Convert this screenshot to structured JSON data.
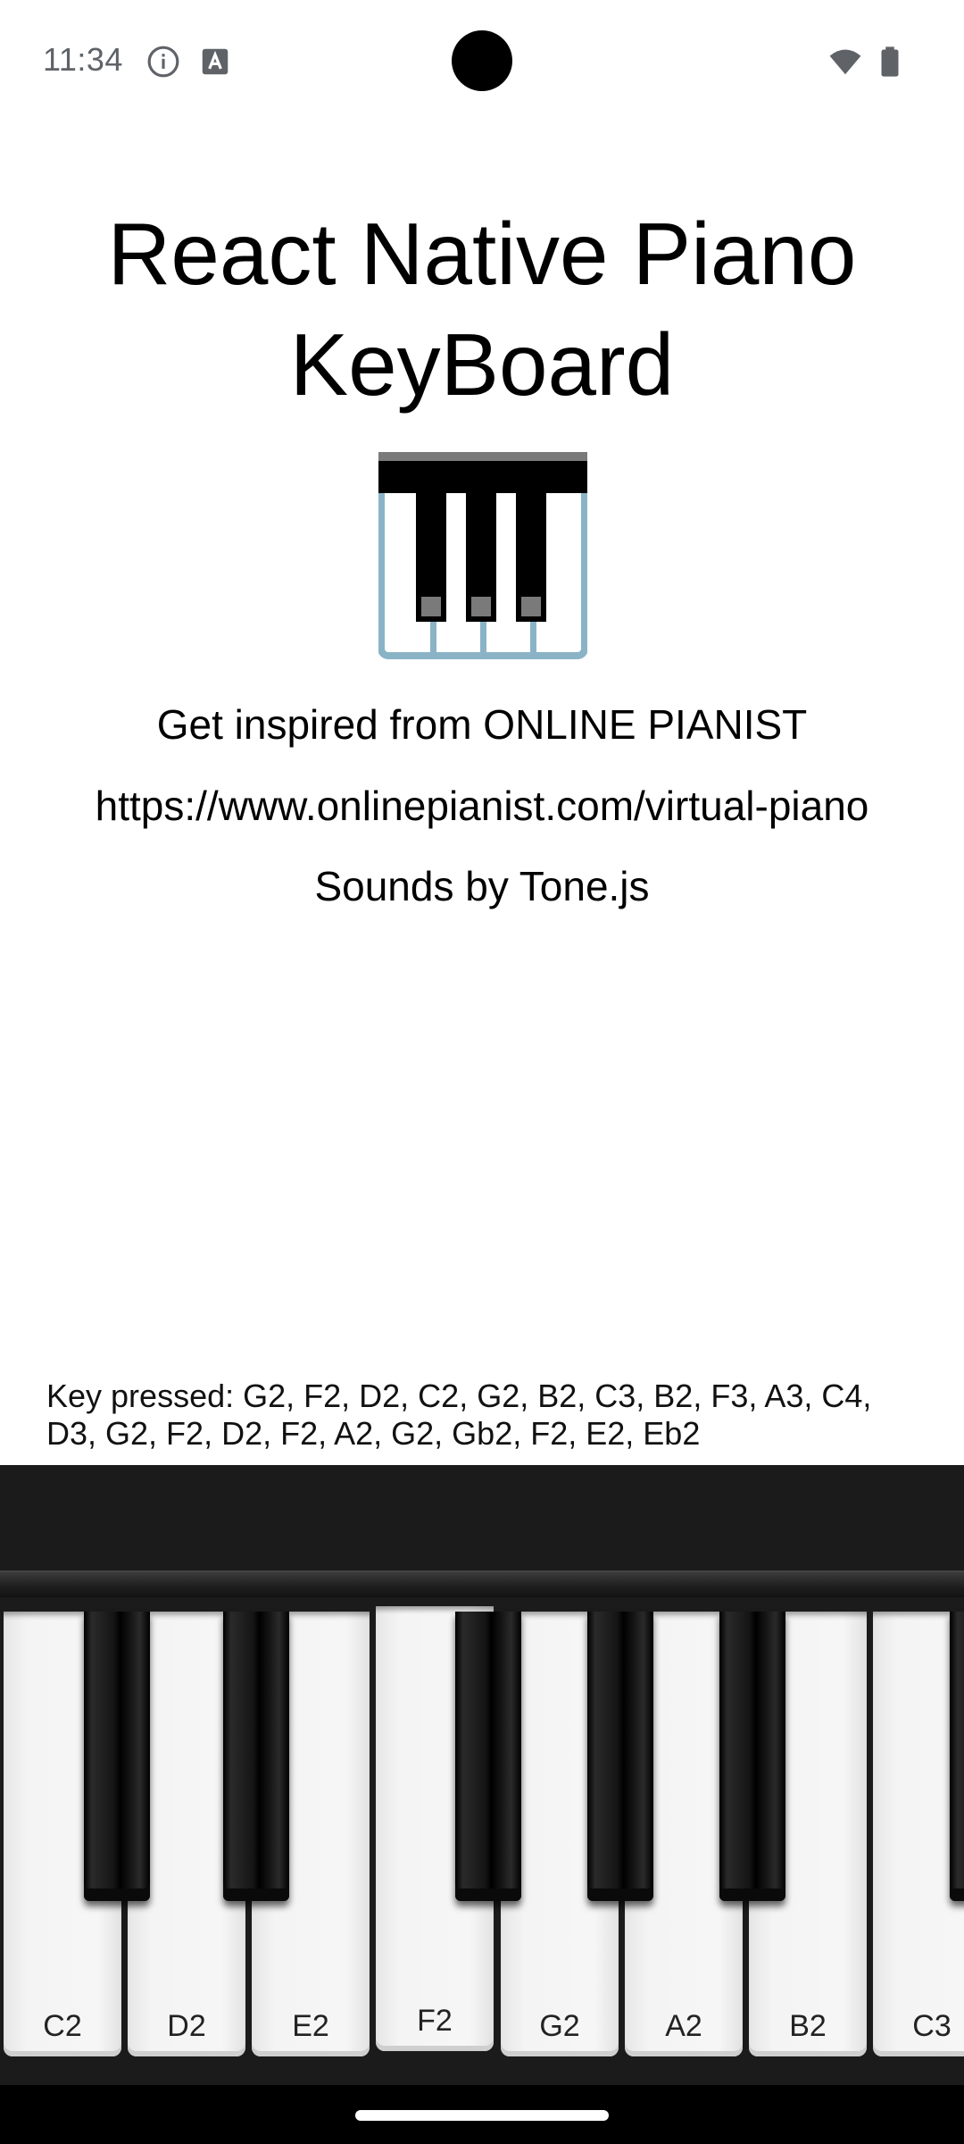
{
  "status_bar": {
    "time": "11:34",
    "icons": [
      "info-icon",
      "text-a-icon",
      "wifi-icon",
      "battery-icon"
    ]
  },
  "header": {
    "title": "React Native Piano KeyBoard",
    "logo_icon": "piano-keys-icon",
    "inspired_line": "Get inspired from ONLINE PIANIST",
    "url_line": "https://www.onlinepianist.com/virtual-piano",
    "sounds_line": "Sounds by Tone.js"
  },
  "key_pressed": "Key pressed: G2, F2, D2, C2, G2, B2, C3, B2, F3, A3, C4, D3, G2, F2, D2, F2, A2, G2, Gb2, F2, E2, Eb2",
  "keyboard": {
    "white_keys": [
      {
        "label": "C2"
      },
      {
        "label": "D2"
      },
      {
        "label": "E2"
      },
      {
        "label": "F2"
      },
      {
        "label": "G2"
      },
      {
        "label": "A2"
      },
      {
        "label": "B2"
      },
      {
        "label": "C3"
      }
    ],
    "black_keys": [
      "Db2",
      "Eb2",
      "Gb2",
      "Ab2",
      "Bb2",
      "Db3"
    ]
  },
  "colors": {
    "logo_frame": "#8ab4c6",
    "keyboard_bg": "#1b1b1b",
    "status_text": "#5f6368"
  }
}
